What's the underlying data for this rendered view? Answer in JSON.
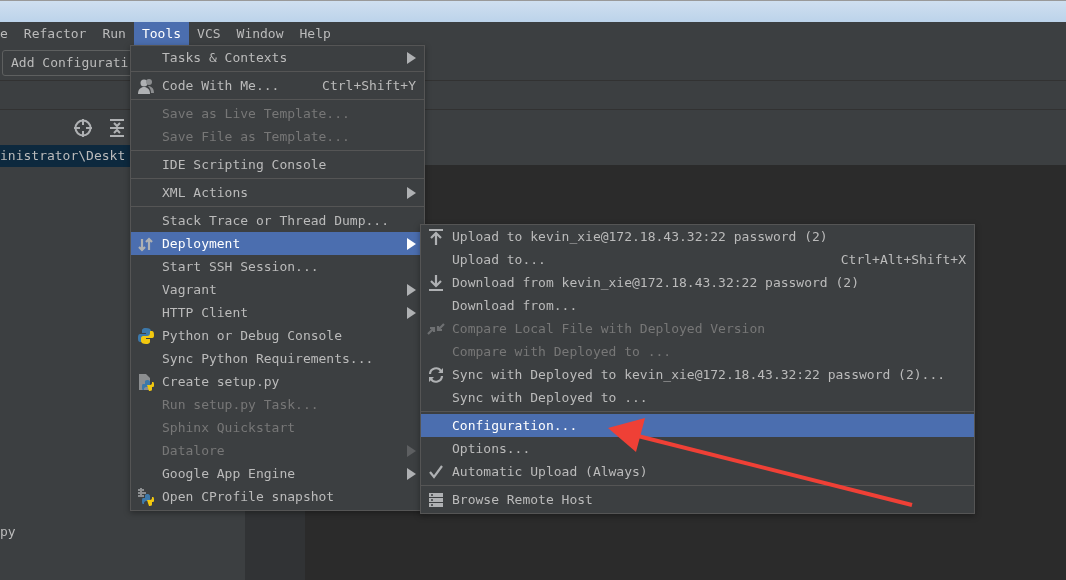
{
  "menubar": [
    {
      "label": "e",
      "selected": false
    },
    {
      "label": "Refactor",
      "selected": false
    },
    {
      "label": "Run",
      "selected": false
    },
    {
      "label": "Tools",
      "selected": true
    },
    {
      "label": "VCS",
      "selected": false
    },
    {
      "label": "Window",
      "selected": false
    },
    {
      "label": "Help",
      "selected": false
    }
  ],
  "toolbar": {
    "run_config_button": "Add Configurati"
  },
  "project_panel": {
    "selected_row": "inistrator\\Deskt",
    "file_row": "py"
  },
  "tools_menu": {
    "items": [
      {
        "kind": "item",
        "label": "Tasks & Contexts",
        "disabled": false,
        "selected": false,
        "submenu": true
      },
      {
        "kind": "separator"
      },
      {
        "kind": "item",
        "label": "Code With Me...",
        "shortcut": "Ctrl+Shift+Y",
        "disabled": false,
        "selected": false,
        "submenu": false
      },
      {
        "kind": "separator"
      },
      {
        "kind": "item",
        "label": "Save as Live Template...",
        "disabled": true,
        "selected": false,
        "submenu": false
      },
      {
        "kind": "item",
        "label": "Save File as Template...",
        "disabled": true,
        "selected": false,
        "submenu": false
      },
      {
        "kind": "separator"
      },
      {
        "kind": "item",
        "label": "IDE Scripting Console",
        "disabled": false,
        "selected": false,
        "submenu": false
      },
      {
        "kind": "separator"
      },
      {
        "kind": "item",
        "label": "XML Actions",
        "disabled": false,
        "selected": false,
        "submenu": true
      },
      {
        "kind": "separator"
      },
      {
        "kind": "item",
        "label": "Stack Trace or Thread Dump...",
        "disabled": false,
        "selected": false,
        "submenu": false
      },
      {
        "kind": "item",
        "label": "Deployment",
        "disabled": false,
        "selected": true,
        "submenu": true
      },
      {
        "kind": "item",
        "label": "Start SSH Session...",
        "disabled": false,
        "selected": false,
        "submenu": false
      },
      {
        "kind": "item",
        "label": "Vagrant",
        "disabled": false,
        "selected": false,
        "submenu": true
      },
      {
        "kind": "item",
        "label": "HTTP Client",
        "disabled": false,
        "selected": false,
        "submenu": true
      },
      {
        "kind": "item",
        "label": "Python or Debug Console",
        "disabled": false,
        "selected": false,
        "submenu": false
      },
      {
        "kind": "item",
        "label": "Sync Python Requirements...",
        "disabled": false,
        "selected": false,
        "submenu": false
      },
      {
        "kind": "item",
        "label": "Create setup.py",
        "disabled": false,
        "selected": false,
        "submenu": false
      },
      {
        "kind": "item",
        "label": "Run setup.py Task...",
        "disabled": true,
        "selected": false,
        "submenu": false
      },
      {
        "kind": "item",
        "label": "Sphinx Quickstart",
        "disabled": true,
        "selected": false,
        "submenu": false
      },
      {
        "kind": "item",
        "label": "Datalore",
        "disabled": true,
        "selected": false,
        "submenu": true
      },
      {
        "kind": "item",
        "label": "Google App Engine",
        "disabled": false,
        "selected": false,
        "submenu": true
      },
      {
        "kind": "item",
        "label": "Open CProfile snapshot",
        "disabled": false,
        "selected": false,
        "submenu": false
      }
    ]
  },
  "deployment_submenu": {
    "items": [
      {
        "kind": "item",
        "label": "Upload to kevin_xie@172.18.43.32:22 password (2)",
        "disabled": false,
        "selected": false,
        "checked": false
      },
      {
        "kind": "item",
        "label": "Upload to...",
        "shortcut": "Ctrl+Alt+Shift+X",
        "disabled": false,
        "selected": false,
        "checked": false
      },
      {
        "kind": "item",
        "label": "Download from kevin_xie@172.18.43.32:22 password (2)",
        "disabled": false,
        "selected": false,
        "checked": false
      },
      {
        "kind": "item",
        "label": "Download from...",
        "disabled": false,
        "selected": false,
        "checked": false
      },
      {
        "kind": "item",
        "label": "Compare Local File with Deployed Version",
        "disabled": true,
        "selected": false,
        "checked": false
      },
      {
        "kind": "item",
        "label": "Compare with Deployed to ...",
        "disabled": true,
        "selected": false,
        "checked": false
      },
      {
        "kind": "item",
        "label": "Sync with Deployed to kevin_xie@172.18.43.32:22 password (2)...",
        "disabled": false,
        "selected": false,
        "checked": false
      },
      {
        "kind": "item",
        "label": "Sync with Deployed to ...",
        "disabled": false,
        "selected": false,
        "checked": false
      },
      {
        "kind": "separator"
      },
      {
        "kind": "item",
        "label": "Configuration...",
        "disabled": false,
        "selected": true,
        "checked": false
      },
      {
        "kind": "item",
        "label": "Options...",
        "disabled": false,
        "selected": false,
        "checked": false
      },
      {
        "kind": "item",
        "label": "Automatic Upload (Always)",
        "disabled": false,
        "selected": false,
        "checked": true
      },
      {
        "kind": "separator"
      },
      {
        "kind": "item",
        "label": "Browse Remote Host",
        "disabled": false,
        "selected": false,
        "checked": false
      }
    ]
  }
}
